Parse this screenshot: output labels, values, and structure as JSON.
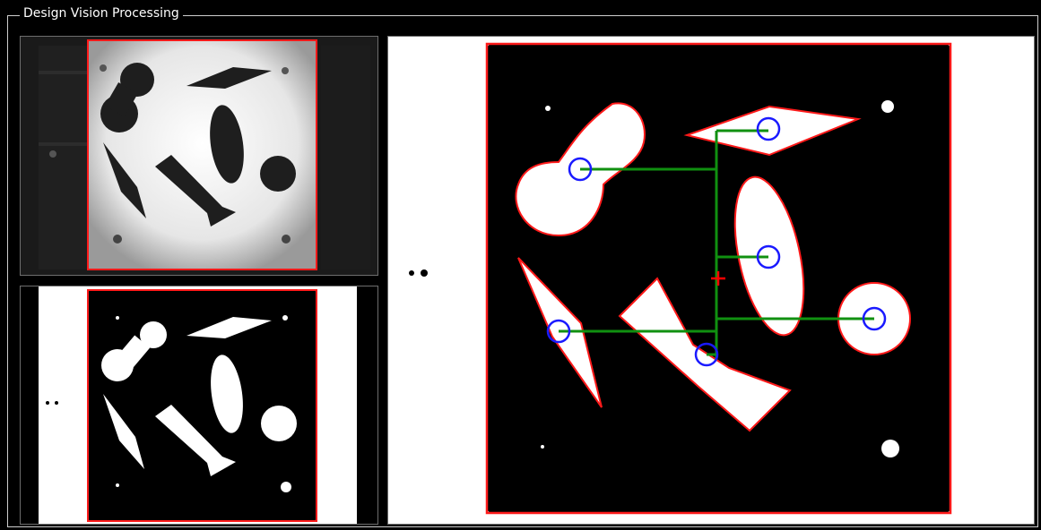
{
  "group": {
    "title": "Design Vision Processing"
  },
  "colors": {
    "roi": "#ff1a1a",
    "center_circle": "#1a1aff",
    "link_line": "#109010",
    "center_cross": "#ff0000",
    "panel_border": "#6e6e6e"
  },
  "panels": [
    {
      "name": "camera-original-view"
    },
    {
      "name": "binary-threshold-view"
    },
    {
      "name": "analysis-result-view"
    }
  ]
}
